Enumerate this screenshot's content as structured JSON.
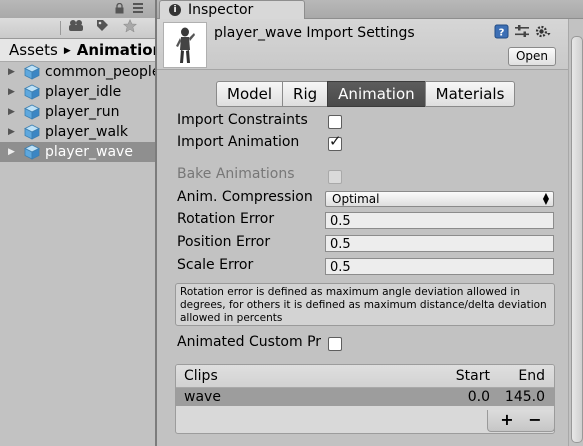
{
  "project": {
    "breadcrumb": {
      "root": "Assets",
      "current": "Animations"
    },
    "assets": [
      {
        "name": "common_people"
      },
      {
        "name": "player_idle"
      },
      {
        "name": "player_run"
      },
      {
        "name": "player_walk"
      },
      {
        "name": "player_wave",
        "selected": true
      }
    ]
  },
  "inspector": {
    "tab_label": "Inspector",
    "title": "player_wave Import Settings",
    "open_label": "Open",
    "tabs": [
      "Model",
      "Rig",
      "Animation",
      "Materials"
    ],
    "active_tab": "Animation",
    "import_constraints_label": "Import Constraints",
    "import_constraints_checked": false,
    "import_animation_label": "Import Animation",
    "import_animation_checked": true,
    "bake_animations_label": "Bake Animations",
    "anim_compression_label": "Anim. Compression",
    "anim_compression_value": "Optimal",
    "rotation_error_label": "Rotation Error",
    "rotation_error_value": "0.5",
    "position_error_label": "Position Error",
    "position_error_value": "0.5",
    "scale_error_label": "Scale Error",
    "scale_error_value": "0.5",
    "help_text": "Rotation error is defined as maximum angle deviation allowed in degrees, for others it is defined as maximum distance/delta deviation allowed in percents",
    "animated_custom_label": "Animated Custom Pr",
    "clips": {
      "header": {
        "name": "Clips",
        "start": "Start",
        "end": "End"
      },
      "rows": [
        {
          "name": "wave",
          "start": "0.0",
          "end": "145.0"
        }
      ],
      "add_label": "+",
      "remove_label": "−"
    }
  }
}
